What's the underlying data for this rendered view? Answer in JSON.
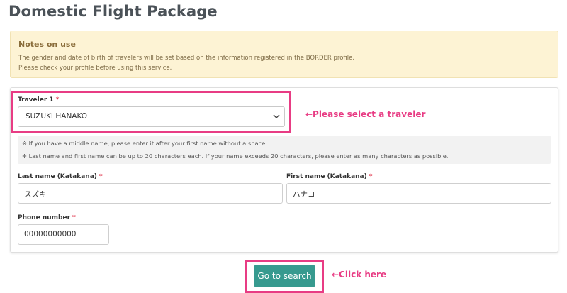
{
  "page": {
    "title": "Domestic Flight Package"
  },
  "notice": {
    "title": "Notes on use",
    "line1": "The gender and date of birth of travelers will be set based on the information registered in the BORDER profile.",
    "line2": "Please check your profile before using this service."
  },
  "traveler": {
    "label": "Traveler 1",
    "required_mark": "*",
    "selected": "SUZUKI HANAKO",
    "annotation": "←Please select a traveler"
  },
  "hints": {
    "line1": "※ If you have a middle name, please enter it after your first name without a space.",
    "line2": "※ Last name and first name can be up to 20 characters each. If your name exceeds 20 characters, please enter as many characters as possible."
  },
  "last_name": {
    "label": "Last name (Katakana)",
    "required_mark": "*",
    "value": "スズキ"
  },
  "first_name": {
    "label": "First name (Katakana)",
    "required_mark": "*",
    "value": "ハナコ"
  },
  "phone": {
    "label": "Phone number",
    "required_mark": "*",
    "value": "00000000000"
  },
  "search": {
    "button_label": "Go to search",
    "annotation": "←Click here"
  },
  "colors": {
    "accent": "#e83c84",
    "button": "#379a8f",
    "notice_bg": "#fdf3d4",
    "required": "#e0334a"
  },
  "icons": {
    "select_chevron": "chevron-down-icon"
  }
}
